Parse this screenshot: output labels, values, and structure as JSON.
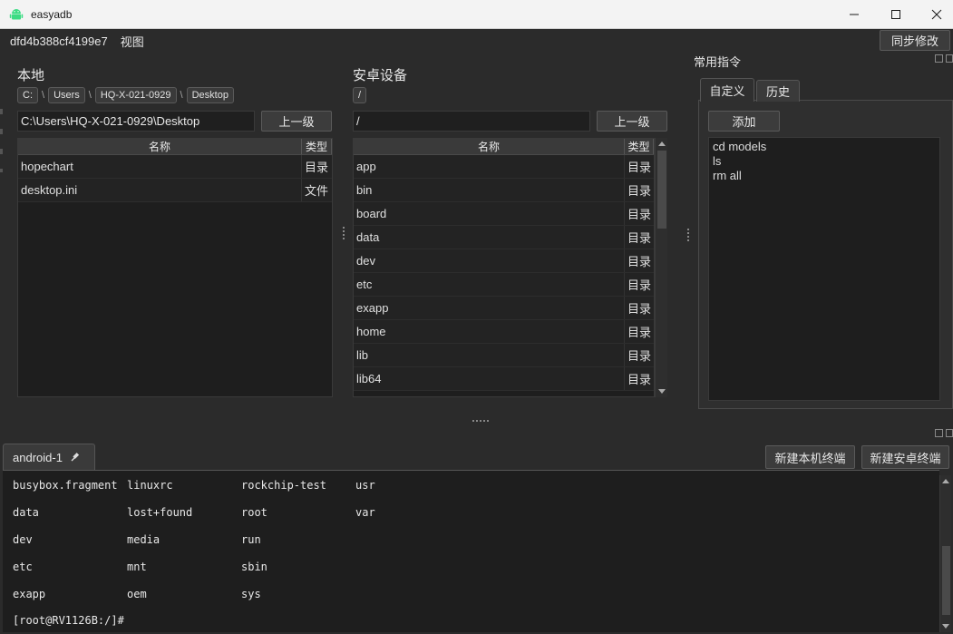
{
  "window": {
    "title": "easyadb"
  },
  "menubar": {
    "device_id": "dfd4b388cf4199e7",
    "view_menu": "视图",
    "sync_button": "同步修改"
  },
  "local": {
    "title": "本地",
    "breadcrumbs": [
      "C:",
      "Users",
      "HQ-X-021-0929",
      "Desktop"
    ],
    "path": "C:\\Users\\HQ-X-021-0929\\Desktop",
    "up_button": "上一级",
    "columns": [
      "名称",
      "类型"
    ],
    "rows": [
      {
        "name": "hopechart",
        "type": "目录"
      },
      {
        "name": "desktop.ini",
        "type": "文件"
      }
    ]
  },
  "android": {
    "title": "安卓设备",
    "breadcrumbs": [
      "/"
    ],
    "path": "/",
    "up_button": "上一级",
    "columns": [
      "名称",
      "类型"
    ],
    "rows": [
      {
        "name": "app",
        "type": "目录"
      },
      {
        "name": "bin",
        "type": "目录"
      },
      {
        "name": "board",
        "type": "目录"
      },
      {
        "name": "data",
        "type": "目录"
      },
      {
        "name": "dev",
        "type": "目录"
      },
      {
        "name": "etc",
        "type": "目录"
      },
      {
        "name": "exapp",
        "type": "目录"
      },
      {
        "name": "home",
        "type": "目录"
      },
      {
        "name": "lib",
        "type": "目录"
      },
      {
        "name": "lib64",
        "type": "目录"
      }
    ]
  },
  "commands": {
    "title": "常用指令",
    "tabs": [
      "自定义",
      "历史"
    ],
    "add_button": "添加",
    "items": [
      "cd models",
      "ls",
      "rm all"
    ]
  },
  "terminal": {
    "tab_label": "android-1",
    "new_local_button": "新建本机终端",
    "new_android_button": "新建安卓终端",
    "lines": [
      [
        "busybox.fragment",
        "linuxrc",
        "rockchip-test",
        "usr"
      ],
      [
        "data",
        "lost+found",
        "root",
        "var"
      ],
      [
        "dev",
        "media",
        "run",
        ""
      ],
      [
        "etc",
        "mnt",
        "sbin",
        ""
      ],
      [
        "exapp",
        "oem",
        "sys",
        ""
      ]
    ],
    "prompt": "[root@RV1126B:/]#"
  },
  "icons": {
    "app": "android-icon",
    "pin": "pin-icon"
  },
  "colors": {
    "accent": "#3ddc84",
    "background": "#2b2b2b"
  }
}
